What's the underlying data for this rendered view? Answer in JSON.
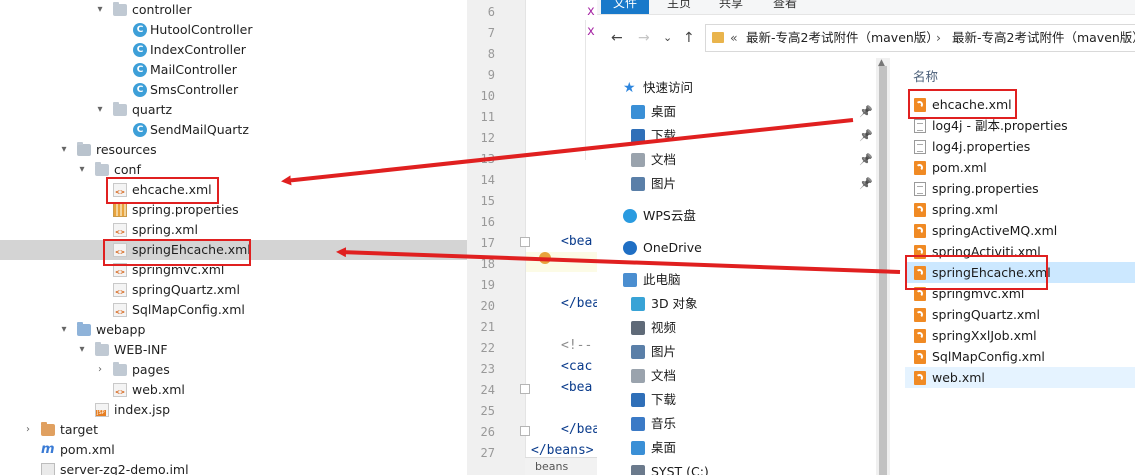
{
  "project_tree": {
    "rows": [
      {
        "label": "controller",
        "icon": "folder-icon",
        "chevron": "▾"
      },
      {
        "label": "HutoolController",
        "icon": "class-icon",
        "chevron": ""
      },
      {
        "label": "IndexController",
        "icon": "class-icon",
        "chevron": ""
      },
      {
        "label": "MailController",
        "icon": "class-icon",
        "chevron": ""
      },
      {
        "label": "SmsController",
        "icon": "class-icon",
        "chevron": ""
      },
      {
        "label": "quartz",
        "icon": "folder-icon",
        "chevron": "▾"
      },
      {
        "label": "SendMailQuartz",
        "icon": "class-icon",
        "chevron": ""
      },
      {
        "label": "resources",
        "icon": "resources-folder-icon",
        "chevron": "▾"
      },
      {
        "label": "conf",
        "icon": "folder-icon",
        "chevron": "▾"
      },
      {
        "label": "ehcache.xml",
        "icon": "xml-file-icon",
        "chevron": ""
      },
      {
        "label": "spring.properties",
        "icon": "properties-file-icon",
        "chevron": ""
      },
      {
        "label": "spring.xml",
        "icon": "xml-file-icon",
        "chevron": ""
      },
      {
        "label": "springEhcache.xml",
        "icon": "xml-file-icon",
        "chevron": ""
      },
      {
        "label": "springmvc.xml",
        "icon": "xml-file-icon",
        "chevron": ""
      },
      {
        "label": "springQuartz.xml",
        "icon": "xml-file-icon",
        "chevron": ""
      },
      {
        "label": "SqlMapConfig.xml",
        "icon": "xml-file-icon",
        "chevron": ""
      },
      {
        "label": "webapp",
        "icon": "web-folder-icon",
        "chevron": "▾"
      },
      {
        "label": "WEB-INF",
        "icon": "folder-icon",
        "chevron": "▾"
      },
      {
        "label": "pages",
        "icon": "folder-icon",
        "chevron": "›"
      },
      {
        "label": "web.xml",
        "icon": "xml-file-icon",
        "chevron": ""
      },
      {
        "label": "index.jsp",
        "icon": "jsp-file-icon",
        "chevron": ""
      },
      {
        "label": "target",
        "icon": "target-folder-icon",
        "chevron": "›"
      },
      {
        "label": "pom.xml",
        "icon": "maven-pom-icon",
        "chevron": ""
      },
      {
        "label": "server-zq2-demo.iml",
        "icon": "iml-file-icon",
        "chevron": ""
      }
    ],
    "selected_row": "springEhcache.xml"
  },
  "editor": {
    "line_numbers": [
      "6",
      "7",
      "8",
      "9",
      "10",
      "11",
      "12",
      "13",
      "14",
      "15",
      "16",
      "17",
      "18",
      "19",
      "20",
      "21",
      "22",
      "23",
      "24",
      "25",
      "26",
      "27"
    ],
    "code_lines": {
      "l6": "x",
      "l7": "x",
      "l17": "<bea",
      "l20": "</bea",
      "l22": "<!--",
      "l23": "<cac",
      "l24": "<bea",
      "l26": "</bea",
      "l27": "</beans>"
    },
    "tab_label": "beans"
  },
  "explorer": {
    "ribbon_tabs": [
      "文件",
      "主页",
      "共享",
      "查看"
    ],
    "nav_buttons": {
      "back": "←",
      "forward": "→",
      "dropdown": "⌄",
      "up": "↑"
    },
    "breadcrumb": {
      "prefix": "«",
      "items": [
        "最新-专高2考试附件（maven版）",
        "最新-专高2考试附件（maven版）"
      ]
    },
    "nav_pane": [
      {
        "label": "快速访问",
        "icon": "star-icon",
        "pinned": false
      },
      {
        "label": "桌面",
        "icon": "desktop-icon",
        "pinned": true
      },
      {
        "label": "下载",
        "icon": "download-icon",
        "pinned": true
      },
      {
        "label": "文档",
        "icon": "document-icon",
        "pinned": true
      },
      {
        "label": "图片",
        "icon": "pictures-icon",
        "pinned": true
      },
      {
        "label": "WPS云盘",
        "icon": "cloud-icon",
        "pinned": false
      },
      {
        "label": "OneDrive",
        "icon": "onedrive-icon",
        "pinned": false
      },
      {
        "label": "此电脑",
        "icon": "computer-icon",
        "pinned": false
      },
      {
        "label": "3D 对象",
        "icon": "3d-objects-icon",
        "pinned": false
      },
      {
        "label": "视频",
        "icon": "video-icon",
        "pinned": false
      },
      {
        "label": "图片",
        "icon": "pictures-icon",
        "pinned": false
      },
      {
        "label": "文档",
        "icon": "document-icon",
        "pinned": false
      },
      {
        "label": "下载",
        "icon": "download-icon",
        "pinned": false
      },
      {
        "label": "音乐",
        "icon": "music-icon",
        "pinned": false
      },
      {
        "label": "桌面",
        "icon": "desktop-icon",
        "pinned": false
      },
      {
        "label": "SYST (C:)",
        "icon": "drive-icon",
        "pinned": false
      }
    ],
    "pin_glyph": "📌",
    "column_header": "名称",
    "files": [
      {
        "name": "ehcache.xml",
        "icon": "xml-file-icon"
      },
      {
        "name": "log4j - 副本.properties",
        "icon": "text-file-icon"
      },
      {
        "name": "log4j.properties",
        "icon": "text-file-icon"
      },
      {
        "name": "pom.xml",
        "icon": "xml-file-icon"
      },
      {
        "name": "spring.properties",
        "icon": "text-file-icon"
      },
      {
        "name": "spring.xml",
        "icon": "xml-file-icon"
      },
      {
        "name": "springActiveMQ.xml",
        "icon": "xml-file-icon"
      },
      {
        "name": "springActiviti.xml",
        "icon": "xml-file-icon"
      },
      {
        "name": "springEhcache.xml",
        "icon": "xml-file-icon"
      },
      {
        "name": "springmvc.xml",
        "icon": "xml-file-icon"
      },
      {
        "name": "springQuartz.xml",
        "icon": "xml-file-icon"
      },
      {
        "name": "springXxlJob.xml",
        "icon": "xml-file-icon"
      },
      {
        "name": "SqlMapConfig.xml",
        "icon": "xml-file-icon"
      },
      {
        "name": "web.xml",
        "icon": "xml-file-icon"
      }
    ],
    "selected_file": "springEhcache.xml",
    "hovered_file": "web.xml"
  },
  "colors": {
    "annotation_red": "#e02020",
    "ide_selection": "#d4d4d4",
    "explorer_selection": "#cce8ff",
    "ribbon_file_tab": "#1979ca"
  }
}
